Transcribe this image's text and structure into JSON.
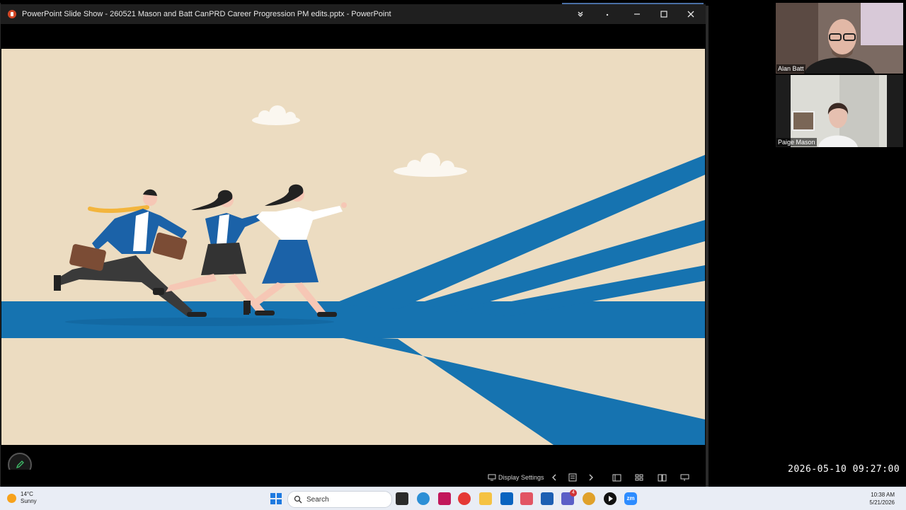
{
  "window": {
    "title": "PowerPoint Slide Show  -  260521 Mason and Batt CanPRD Career Progression PM edits.pptx - PowerPoint"
  },
  "toolbar": {
    "display_settings": "Display Settings"
  },
  "participants": [
    {
      "name": "Alan Batt"
    },
    {
      "name": "Paige Mason"
    }
  ],
  "timestamp": "2026-05-10  09:27:00",
  "taskbar": {
    "weather_temp": "14°C",
    "weather_desc": "Sunny",
    "search_placeholder": "Search",
    "time": "10:38 AM",
    "date": "5/21/2026",
    "teams_badge": "4"
  },
  "colors": {
    "slide_background": "#ecdcc1",
    "road_blue": "#1673b0",
    "jacket_blue": "#1b62a8",
    "tie_yellow": "#f3b53d"
  }
}
